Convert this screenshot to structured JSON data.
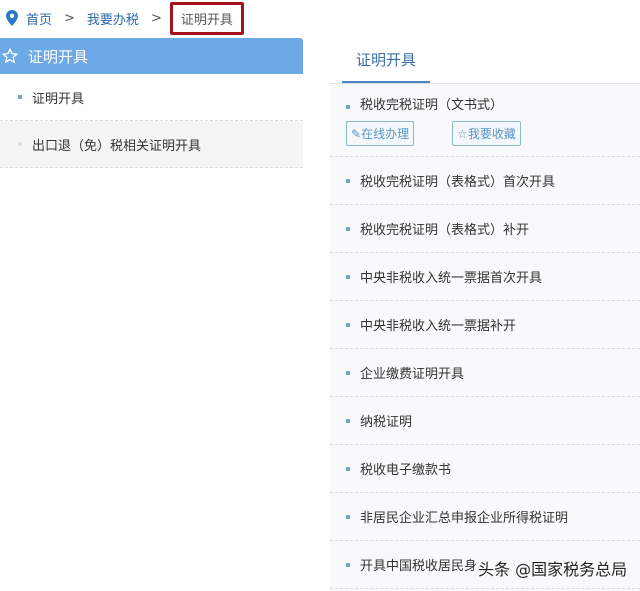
{
  "breadcrumb": {
    "home": "首页",
    "level2": "我要办税",
    "current": "证明开具",
    "separator": ">"
  },
  "sidebar": {
    "title": "证明开具",
    "items": [
      {
        "label": "证明开具"
      },
      {
        "label": "出口退（免）税相关证明开具"
      }
    ]
  },
  "main": {
    "tab": "证明开具",
    "first_item": {
      "label": "税收完税证明（文书式）",
      "online_button": "在线办理",
      "favorite_button": "我要收藏"
    },
    "items": [
      "税收完税证明（表格式）首次开具",
      "税收完税证明（表格式）补开",
      "中央非税收入统一票据首次开具",
      "中央非税收入统一票据补开",
      "企业缴费证明开具",
      "纳税证明",
      "税收电子缴款书",
      "非居民企业汇总申报企业所得税证明",
      "开具中国税收居民身"
    ]
  },
  "watermark": "头条 @国家税务总局"
}
